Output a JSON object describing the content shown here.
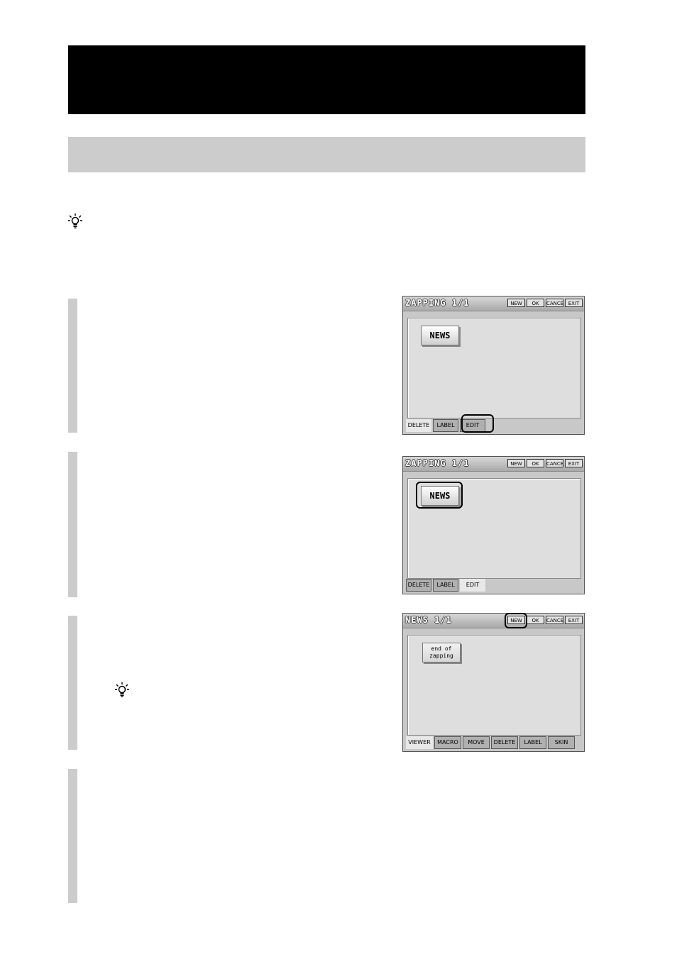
{
  "screens": [
    {
      "title": "ZAPPING 1/1",
      "top_buttons": [
        "NEW",
        "OK",
        "CANCEL",
        "EXIT"
      ],
      "item": "NEWS",
      "tabs": [
        "DELETE",
        "LABEL",
        "EDIT"
      ],
      "active_tab": "DELETE"
    },
    {
      "title": "ZAPPING 1/1",
      "top_buttons": [
        "NEW",
        "OK",
        "CANCEL",
        "EXIT"
      ],
      "item": "NEWS",
      "tabs": [
        "DELETE",
        "LABEL",
        "EDIT"
      ],
      "active_tab": "EDIT"
    },
    {
      "title": "NEWS 1/1",
      "top_buttons": [
        "NEW",
        "OK",
        "CANCEL",
        "EXIT"
      ],
      "item": "end of\nzapping",
      "tabs": [
        "VIEWER",
        "MACRO",
        "MOVE",
        "DELETE",
        "LABEL",
        "SKIN"
      ],
      "active_tab": "VIEWER"
    }
  ]
}
